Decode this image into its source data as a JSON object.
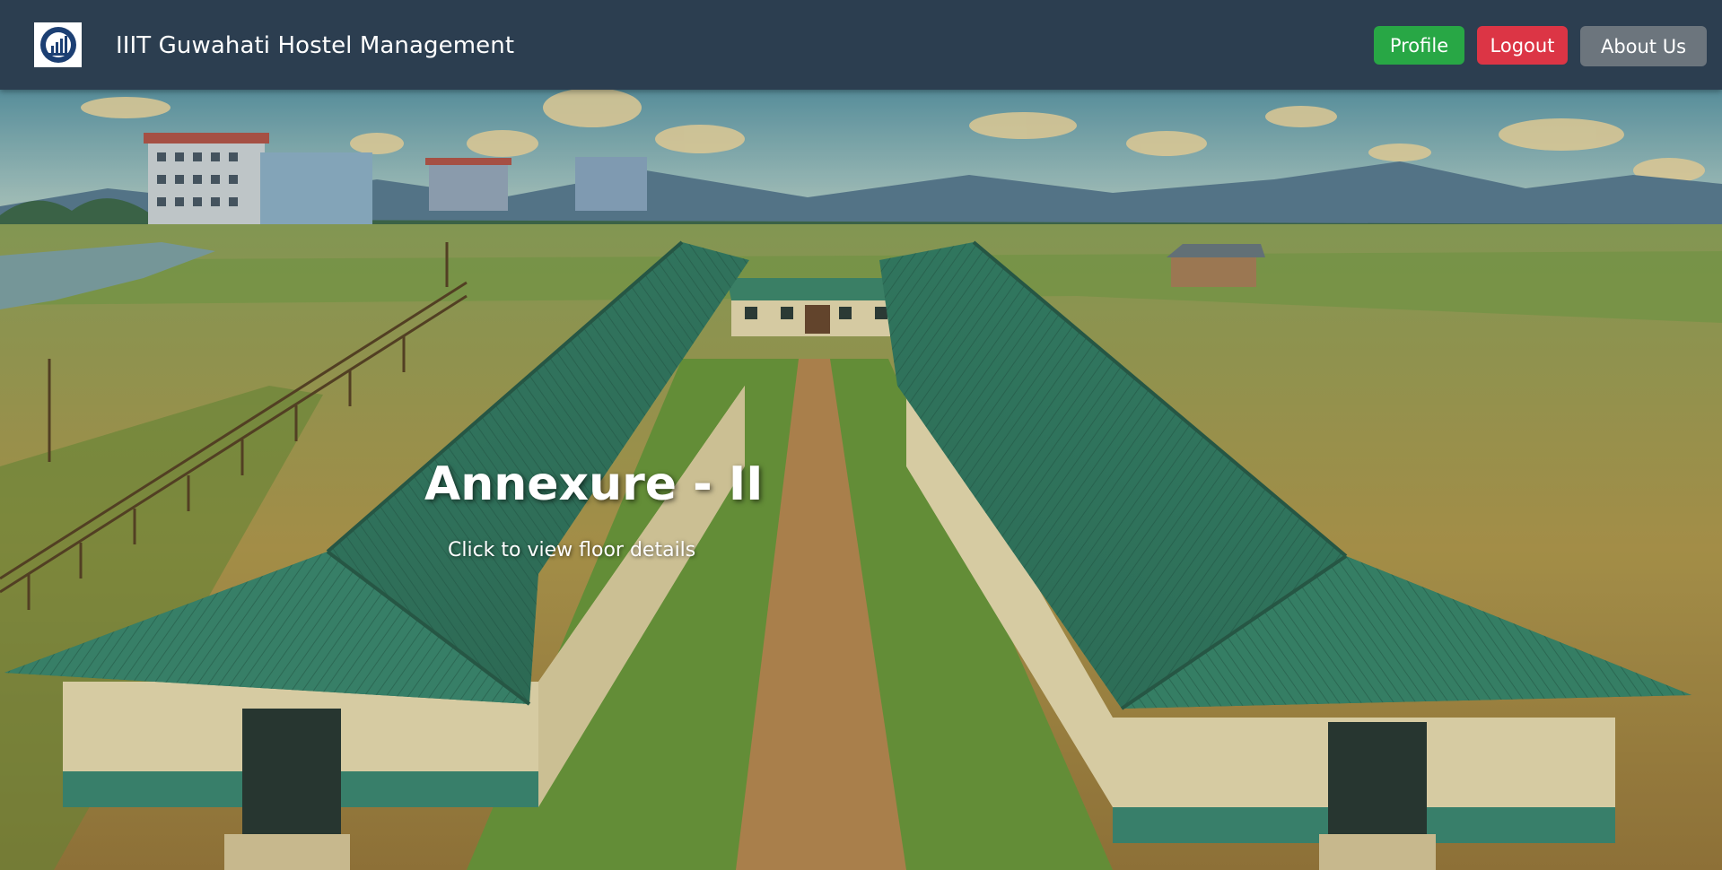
{
  "navbar": {
    "logo_icon": "hostel-logo-icon",
    "title": "IIIT Guwahati Hostel Management",
    "profile_label": "Profile",
    "logout_label": "Logout",
    "about_label": "About Us"
  },
  "hero": {
    "title": "Annexure - II",
    "subtitle": "Click to view floor details"
  },
  "colors": {
    "navbar_bg": "#2c3e50",
    "profile_btn": "#28a745",
    "logout_btn": "#dc3545",
    "about_btn": "#6c757d",
    "roof_green": "#3f8a6e"
  }
}
